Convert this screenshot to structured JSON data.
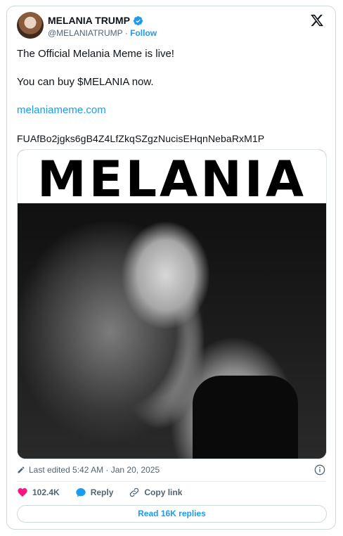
{
  "author": {
    "display_name": "MELANIA TRUMP",
    "handle": "@MELANIATRUMP",
    "separator": " · ",
    "follow_label": "Follow"
  },
  "tweet": {
    "line1": "The Official Melania Meme is live!",
    "line2": "You can buy $MELANIA now.",
    "link": "melaniameme.com",
    "address": "FUAfBo2jgks6gB4Z4LfZkqSZgzNucisEHqnNebaRxM1P"
  },
  "media": {
    "title_text": "MELANIA"
  },
  "meta": {
    "edited_text": "Last edited 5:42 AM · Jan 20, 2025"
  },
  "actions": {
    "like_count": "102.4K",
    "reply_label": "Reply",
    "copy_link_label": "Copy link"
  },
  "read_replies_label": "Read 16K replies",
  "colors": {
    "accent": "#1d9bf0",
    "like": "#f91880",
    "text": "#0f1419",
    "muted": "#536471"
  },
  "icons": [
    "verified-badge-icon",
    "x-logo-icon",
    "pencil-icon",
    "info-icon",
    "heart-icon",
    "reply-bubble-icon",
    "link-icon"
  ]
}
